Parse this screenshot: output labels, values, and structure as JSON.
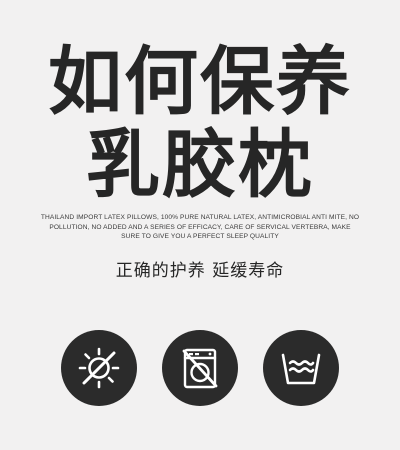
{
  "title": {
    "line1": "如何保养",
    "line2": "乳胶枕"
  },
  "description": "THAILAND IMPORT LATEX PILLOWS, 100% PURE NATURAL LATEX, ANTIMICROBIAL ANTI MITE, NO POLLUTION, NO ADDED AND A SERIES OF EFFICACY, CARE OF SERVICAL VERTEBRA, MAKE SURE TO GIVE YOU A PERFECT SLEEP QUALITY",
  "subtitle": "正确的护养  延缓寿命",
  "icons": [
    {
      "name": "no-sun-exposure-icon"
    },
    {
      "name": "no-machine-wash-icon"
    },
    {
      "name": "hand-wash-basin-icon"
    }
  ],
  "colors": {
    "background": "#f2f1f1",
    "text": "#262626",
    "icon_circle": "#2b2b2b",
    "icon_glyph": "#ffffff"
  }
}
